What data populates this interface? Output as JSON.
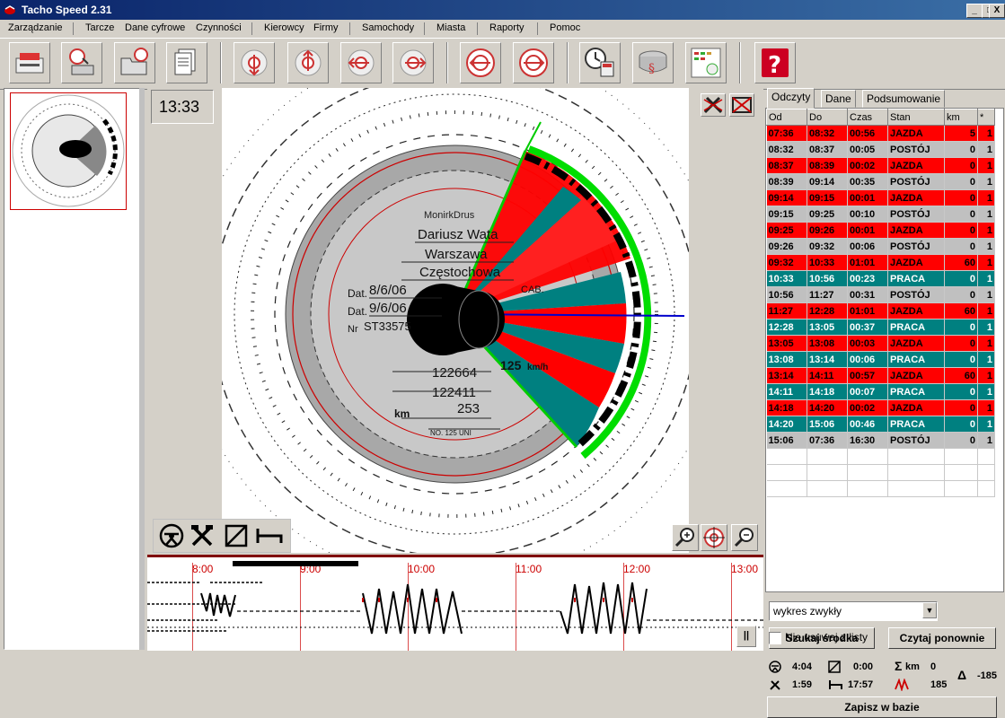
{
  "window": {
    "title": "Tacho Speed 2.31",
    "btn_min": "_",
    "btn_max": "□",
    "btn_close": "X"
  },
  "menu": [
    "Zarządzanie",
    "Tarcze",
    "Dane cyfrowe",
    "Czynności",
    "Kierowcy",
    "Firmy",
    "Samochody",
    "Miasta",
    "Raporty",
    "Pomoc"
  ],
  "clock": "13:33",
  "disc": {
    "driver_line1": "MonirkDrus",
    "driver_name": "Dariusz Wata",
    "from_city": "Warszawa",
    "to_city": "Częstochowa",
    "dat_label": "Dat.",
    "date_from": "8/6/06",
    "date_to": "9/6/06",
    "nr_label": "Nr",
    "reg": "ST33575",
    "speed": "125",
    "speed_unit": "km/h",
    "odo_end": "122664",
    "odo_start": "122411",
    "km_label": "km",
    "km_total": "253",
    "disc_no": "NO. 125 UNI",
    "cab": "CAB."
  },
  "graph_hours": [
    "8:00",
    "9:00",
    "10:00",
    "11:00",
    "12:00",
    "13:00"
  ],
  "graph_button": "||",
  "tabs": [
    "Odczyty",
    "Dane",
    "Podsumowanie"
  ],
  "table": {
    "headers": [
      "Od",
      "Do",
      "Czas",
      "Stan",
      "km",
      "*"
    ],
    "rows": [
      {
        "od": "07:36",
        "do": "08:32",
        "czas": "00:56",
        "stan": "JAZDA",
        "km": "5",
        "x": "1",
        "type": "jazda"
      },
      {
        "od": "08:32",
        "do": "08:37",
        "czas": "00:05",
        "stan": "POSTÓJ",
        "km": "0",
        "x": "1",
        "type": "postoj"
      },
      {
        "od": "08:37",
        "do": "08:39",
        "czas": "00:02",
        "stan": "JAZDA",
        "km": "0",
        "x": "1",
        "type": "jazda"
      },
      {
        "od": "08:39",
        "do": "09:14",
        "czas": "00:35",
        "stan": "POSTÓJ",
        "km": "0",
        "x": "1",
        "type": "postoj"
      },
      {
        "od": "09:14",
        "do": "09:15",
        "czas": "00:01",
        "stan": "JAZDA",
        "km": "0",
        "x": "1",
        "type": "jazda"
      },
      {
        "od": "09:15",
        "do": "09:25",
        "czas": "00:10",
        "stan": "POSTÓJ",
        "km": "0",
        "x": "1",
        "type": "postoj"
      },
      {
        "od": "09:25",
        "do": "09:26",
        "czas": "00:01",
        "stan": "JAZDA",
        "km": "0",
        "x": "1",
        "type": "jazda"
      },
      {
        "od": "09:26",
        "do": "09:32",
        "czas": "00:06",
        "stan": "POSTÓJ",
        "km": "0",
        "x": "1",
        "type": "postoj"
      },
      {
        "od": "09:32",
        "do": "10:33",
        "czas": "01:01",
        "stan": "JAZDA",
        "km": "60",
        "x": "1",
        "type": "jazda"
      },
      {
        "od": "10:33",
        "do": "10:56",
        "czas": "00:23",
        "stan": "PRACA",
        "km": "0",
        "x": "1",
        "type": "praca"
      },
      {
        "od": "10:56",
        "do": "11:27",
        "czas": "00:31",
        "stan": "POSTÓJ",
        "km": "0",
        "x": "1",
        "type": "postoj"
      },
      {
        "od": "11:27",
        "do": "12:28",
        "czas": "01:01",
        "stan": "JAZDA",
        "km": "60",
        "x": "1",
        "type": "jazda"
      },
      {
        "od": "12:28",
        "do": "13:05",
        "czas": "00:37",
        "stan": "PRACA",
        "km": "0",
        "x": "1",
        "type": "praca"
      },
      {
        "od": "13:05",
        "do": "13:08",
        "czas": "00:03",
        "stan": "JAZDA",
        "km": "0",
        "x": "1",
        "type": "jazda"
      },
      {
        "od": "13:08",
        "do": "13:14",
        "czas": "00:06",
        "stan": "PRACA",
        "km": "0",
        "x": "1",
        "type": "praca"
      },
      {
        "od": "13:14",
        "do": "14:11",
        "czas": "00:57",
        "stan": "JAZDA",
        "km": "60",
        "x": "1",
        "type": "jazda"
      },
      {
        "od": "14:11",
        "do": "14:18",
        "czas": "00:07",
        "stan": "PRACA",
        "km": "0",
        "x": "1",
        "type": "praca"
      },
      {
        "od": "14:18",
        "do": "14:20",
        "czas": "00:02",
        "stan": "JAZDA",
        "km": "0",
        "x": "1",
        "type": "jazda"
      },
      {
        "od": "14:20",
        "do": "15:06",
        "czas": "00:46",
        "stan": "PRACA",
        "km": "0",
        "x": "1",
        "type": "praca"
      },
      {
        "od": "15:06",
        "do": "07:36",
        "czas": "16:30",
        "stan": "POSTÓJ",
        "km": "0",
        "x": "1",
        "type": "postoj"
      }
    ]
  },
  "chart_type_select": "wykres zwykły",
  "btn_search_center": "Szukaj środka",
  "btn_read_again": "Czytaj ponownie",
  "stats": {
    "drive": "4:04",
    "work": "0:00",
    "km_label": "km",
    "km_sum": "0",
    "tools": "1:59",
    "rest": "17:57",
    "speed_val": "185",
    "delta_label": "Δ",
    "delta": "-185"
  },
  "btn_save": "Zapisz w bazie",
  "checkbox_label": "Nie usuwaj z listy",
  "colors": {
    "jazda": "#ff0000",
    "praca": "#008080",
    "postoj": "#c0c0c0",
    "accent": "#0a246a"
  }
}
